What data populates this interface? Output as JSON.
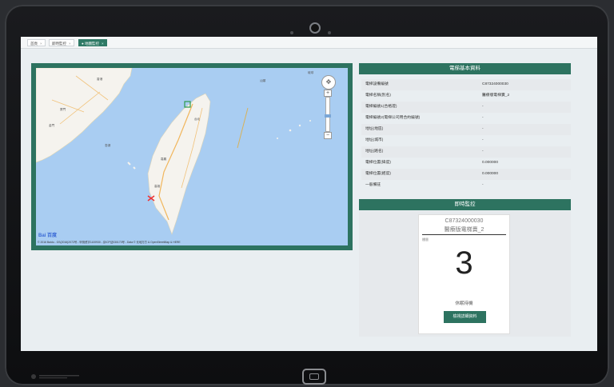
{
  "tabs": [
    {
      "label": "首頁",
      "active": false
    },
    {
      "label": "即時監控",
      "active": false
    },
    {
      "label": "地圖監控",
      "active": true
    }
  ],
  "map": {
    "labels": [
      "金門",
      "台北",
      "嘉義",
      "高雄",
      "澎湖",
      "香港",
      "廈門",
      "汕頭",
      "琉球"
    ],
    "footer": "© 2016 Baidu - GS(2016)2072号 - 甲测资字1100930 - 京ICP证030173号 - Data © 长地万方 & OpenStreetMap & HERE",
    "logo_text": "Bai 百度",
    "zoom_in": "+",
    "zoom_out": "−"
  },
  "info": {
    "title": "電梯基本資料",
    "rows": [
      {
        "key": "電梯設備編號",
        "value": "C87324000030"
      },
      {
        "key": "電梯名稱(別名)",
        "value": "醫療版電梯賣_2"
      },
      {
        "key": "電梯編號1(合格證)",
        "value": "-"
      },
      {
        "key": "電梯編號2(電梯公司用合約編號)",
        "value": "-"
      },
      {
        "key": "地址(地區)",
        "value": "-"
      },
      {
        "key": "地址(城市)",
        "value": "-"
      },
      {
        "key": "地址(路名)",
        "value": "-"
      },
      {
        "key": "電梯位置(緯度)",
        "value": "0.000000"
      },
      {
        "key": "電梯位置(經度)",
        "value": "0.000000"
      },
      {
        "key": "一般備註",
        "value": "-"
      }
    ]
  },
  "monitor": {
    "title": "即時監控",
    "elevator_id": "C87324000030",
    "elevator_name": "醫療版電梯賣_2",
    "floor_label": "樓層",
    "floor": "3",
    "status": "休眠待機",
    "detail_button": "檢視詳細資料"
  },
  "colors": {
    "accent": "#2d7360",
    "sea": "#a9cdf2",
    "land": "#f5f3ee"
  }
}
